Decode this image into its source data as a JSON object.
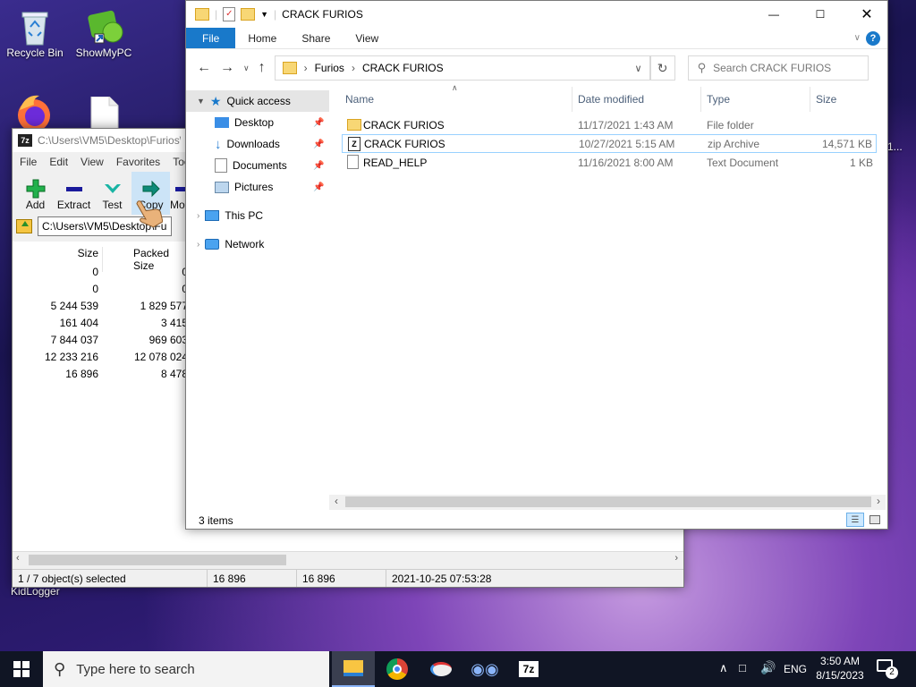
{
  "desktop": {
    "icons": [
      {
        "label": "Recycle Bin",
        "icon": "recycle-bin-icon"
      },
      {
        "label": "ShowMyPC",
        "icon": "showmypc-icon"
      }
    ],
    "hidden_label": "KidLogger",
    "edge_label": "1..."
  },
  "sevenzip": {
    "title": "C:\\Users\\VM5\\Desktop\\Furios\\",
    "menu": [
      "File",
      "Edit",
      "View",
      "Favorites",
      "Tools"
    ],
    "toolbar": [
      {
        "label": "Add",
        "icon": "add-icon"
      },
      {
        "label": "Extract",
        "icon": "extract-icon"
      },
      {
        "label": "Test",
        "icon": "test-icon"
      },
      {
        "label": "Copy",
        "icon": "copy-icon"
      },
      {
        "label": "Mo",
        "icon": "move-icon"
      }
    ],
    "address": "C:\\Users\\VM5\\Desktop\\Fu",
    "columns": {
      "size": "Size",
      "packed": "Packed Size"
    },
    "rows": [
      {
        "size": "0",
        "packed": "0"
      },
      {
        "size": "0",
        "packed": "0"
      },
      {
        "size": "5 244 539",
        "packed": "1 829 577"
      },
      {
        "size": "161 404",
        "packed": "3 415"
      },
      {
        "size": "7 844 037",
        "packed": "969 603"
      },
      {
        "size": "12 233 216",
        "packed": "12 078 024"
      },
      {
        "size": "16 896",
        "packed": "8 478"
      }
    ],
    "status": {
      "selected": "1 / 7 object(s) selected",
      "size1": "16 896",
      "size2": "16 896",
      "modified": "2021-10-25 07:53:28"
    }
  },
  "explorer": {
    "title": "CRACK FURIOS",
    "ribbon_tabs": [
      "File",
      "Home",
      "Share",
      "View"
    ],
    "breadcrumb": [
      "Furios",
      "CRACK FURIOS"
    ],
    "search_placeholder": "Search CRACK FURIOS",
    "nav": {
      "quick_access": "Quick access",
      "items": [
        "Desktop",
        "Downloads",
        "Documents",
        "Pictures"
      ],
      "this_pc": "This PC",
      "network": "Network"
    },
    "columns": {
      "name": "Name",
      "date": "Date modified",
      "type": "Type",
      "size": "Size"
    },
    "files": [
      {
        "name": "CRACK FURIOS",
        "date": "11/17/2021 1:43 AM",
        "type": "File folder",
        "size": "",
        "icon": "folder-icon"
      },
      {
        "name": "CRACK FURIOS",
        "date": "10/27/2021 5:15 AM",
        "type": "zip Archive",
        "size": "14,571 KB",
        "icon": "zip-archive-icon"
      },
      {
        "name": "READ_HELP",
        "date": "11/16/2021 8:00 AM",
        "type": "Text Document",
        "size": "1 KB",
        "icon": "text-document-icon"
      }
    ],
    "status": "3 items"
  },
  "taskbar": {
    "search_placeholder": "Type here to search",
    "language": "ENG",
    "time": "3:50 AM",
    "date": "8/15/2023",
    "notification_count": "2"
  },
  "colors": {
    "accent": "#1979ca",
    "selection": "#cce8ff",
    "taskbar": "#101524"
  }
}
